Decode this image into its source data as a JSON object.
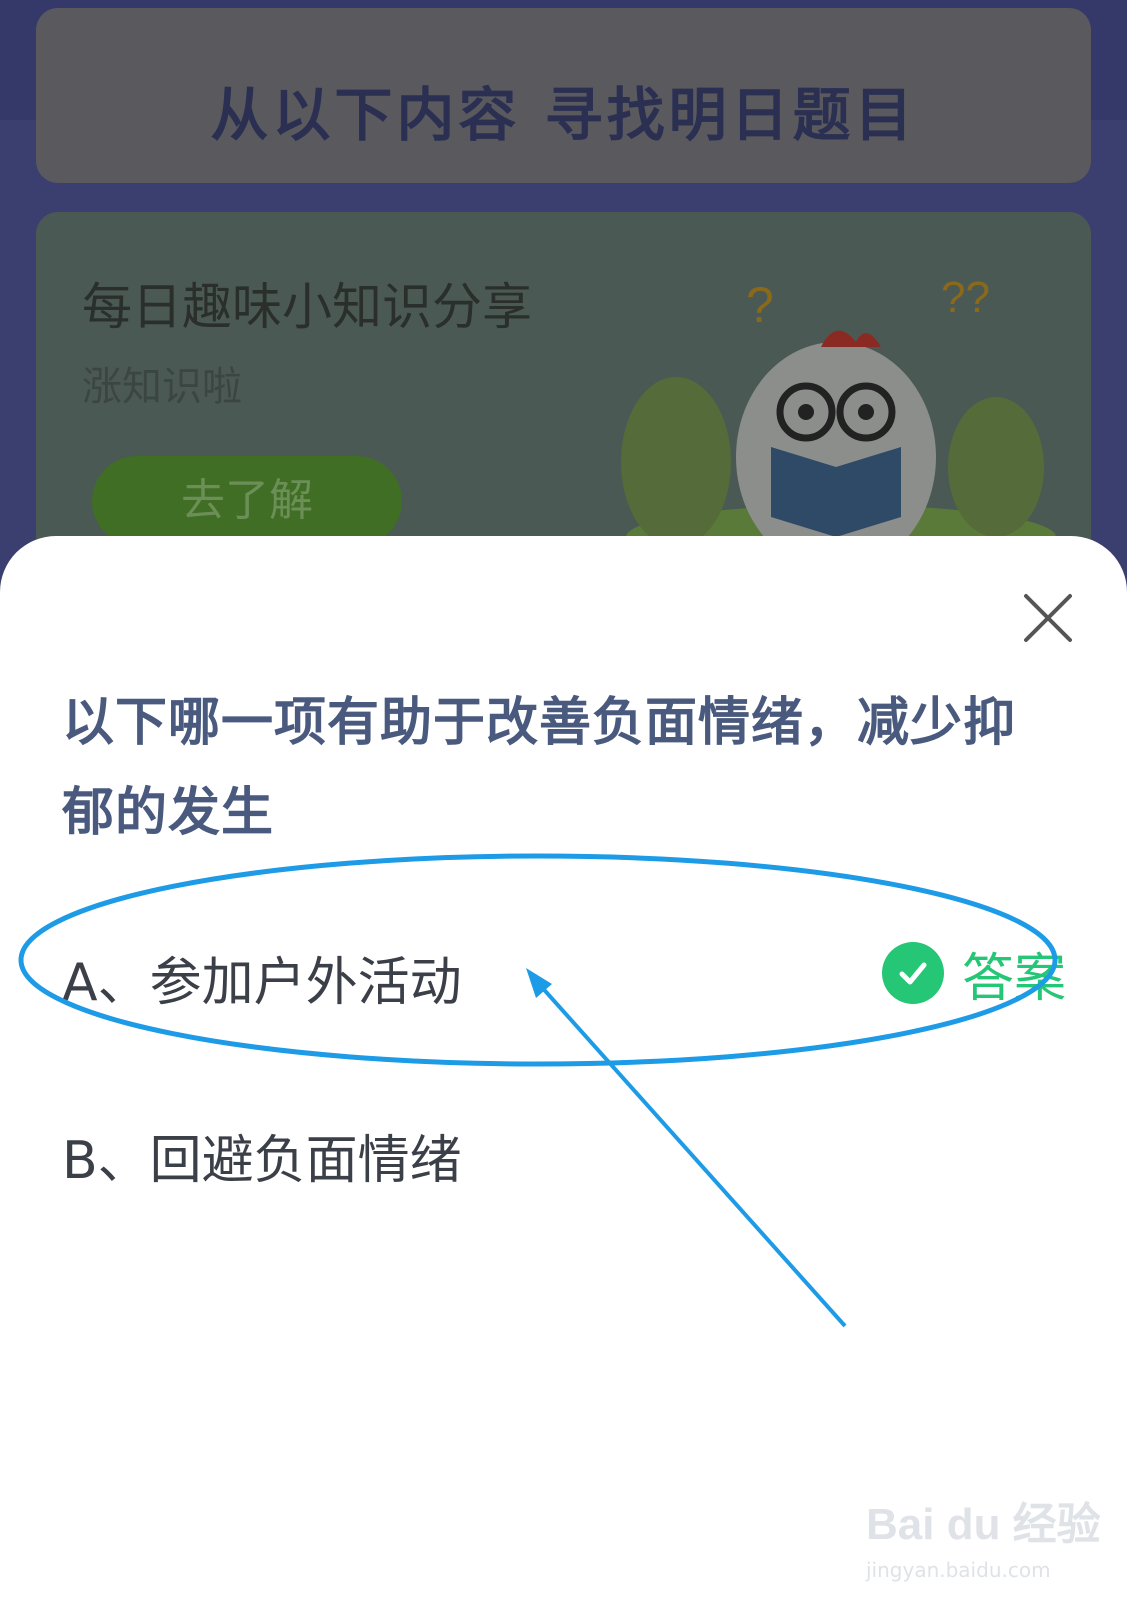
{
  "background": {
    "header_title": "从以下内容 寻找明日题目",
    "promo": {
      "title": "每日趣味小知识分享",
      "subtitle": "涨知识啦",
      "button_label": "去了解"
    }
  },
  "quiz": {
    "question": "以下哪一项有助于改善负面情绪，减少抑郁的发生",
    "options": [
      {
        "label": "A、参加户外活动",
        "is_answer": true
      },
      {
        "label": "B、回避负面情绪",
        "is_answer": false
      }
    ],
    "answer_tag": "答案"
  },
  "colors": {
    "question_text": "#4a5a7e",
    "answer_green": "#25c675",
    "annotation_blue": "#1e9be6"
  },
  "watermark": {
    "main": "Bai du 经验",
    "sub": "jingyan.baidu.com"
  }
}
